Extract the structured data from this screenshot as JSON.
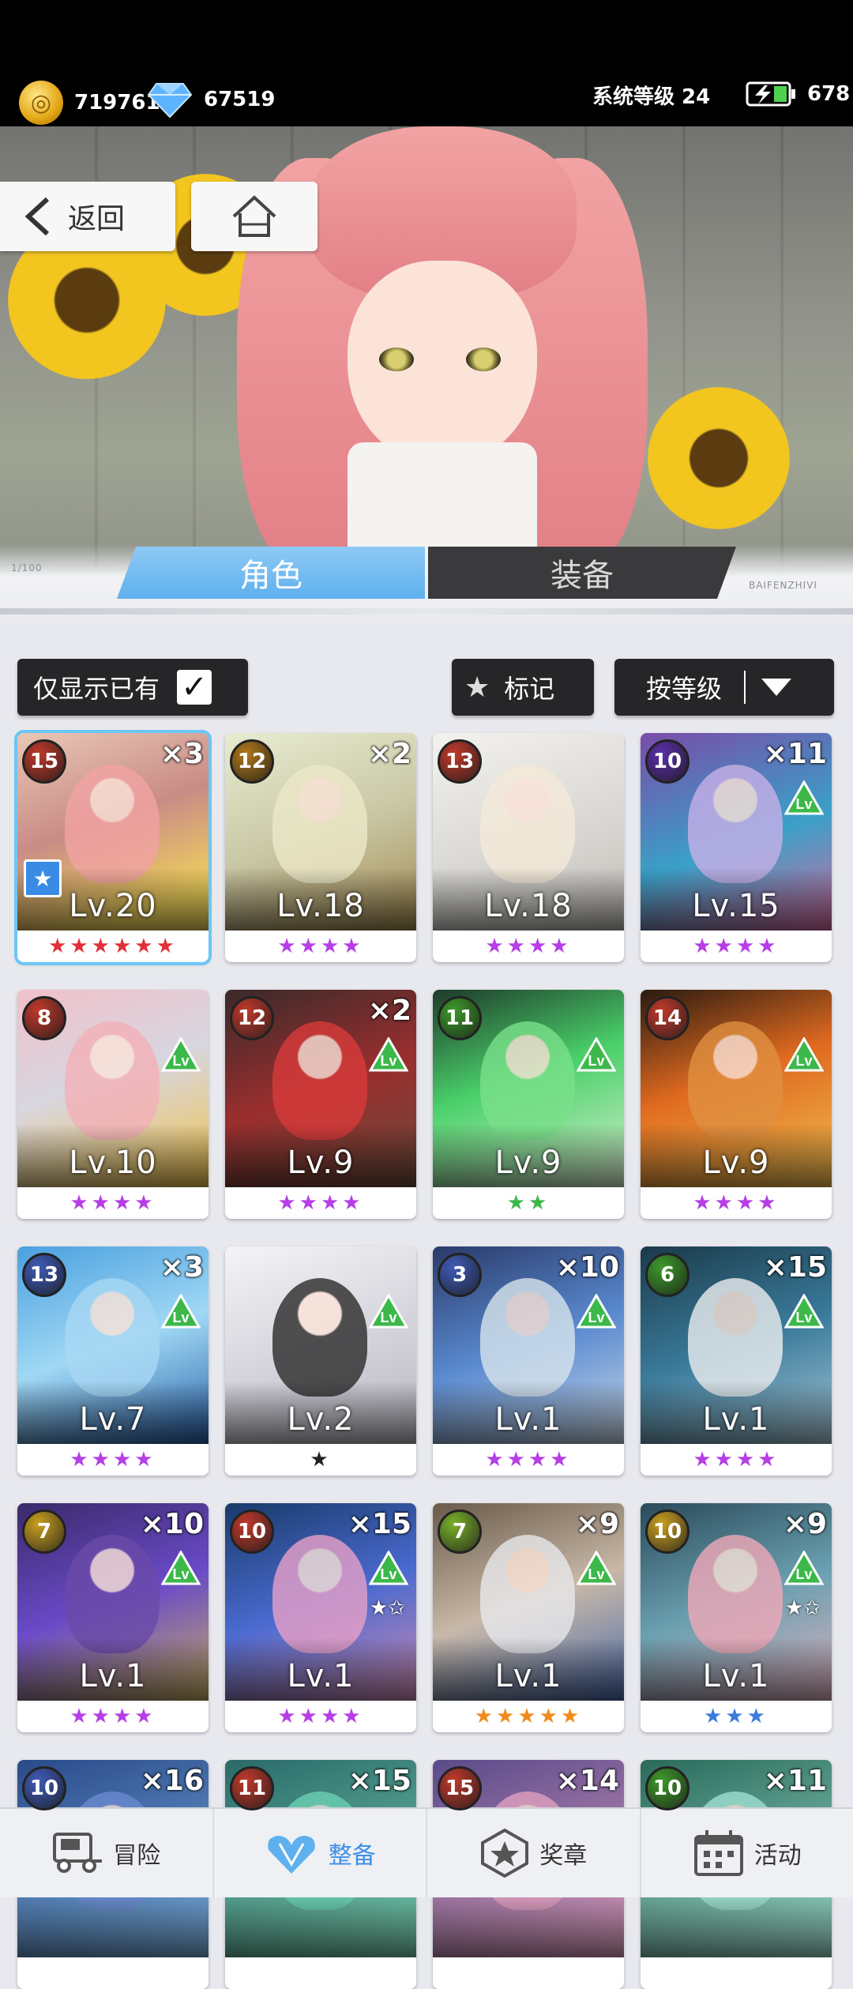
{
  "status": {
    "gold": "719761",
    "diamonds": "67519",
    "system_level": "系统等级 24",
    "energy": "678"
  },
  "nav": {
    "back_label": "返回"
  },
  "tabs": [
    {
      "label": "角色",
      "active": true
    },
    {
      "label": "装备",
      "active": false
    }
  ],
  "decor": {
    "counter": "1/100",
    "right_caption": "BAIFENZHIVI"
  },
  "filters": {
    "owned_only_label": "仅显示已有",
    "owned_only_checked": true,
    "mark_label": "标记",
    "sort_label": "按等级"
  },
  "cards": [
    {
      "rank": "15",
      "mult": "×3",
      "level": "Lv.20",
      "stars": "★★★★★★",
      "star_color": "#e0303a",
      "selected": true,
      "marked": true
    },
    {
      "rank": "12",
      "mult": "×2",
      "level": "Lv.18",
      "stars": "★★★★",
      "star_color": "#b63ee6"
    },
    {
      "rank": "13",
      "mult": "",
      "level": "Lv.18",
      "stars": "★★★★",
      "star_color": "#b63ee6"
    },
    {
      "rank": "10",
      "mult": "×11",
      "level": "Lv.15",
      "stars": "★★★★",
      "star_color": "#b63ee6",
      "lv_up": true
    },
    {
      "rank": "8",
      "mult": "",
      "level": "Lv.10",
      "stars": "★★★★",
      "star_color": "#b63ee6",
      "lv_up": true
    },
    {
      "rank": "12",
      "mult": "×2",
      "level": "Lv.9",
      "stars": "★★★★",
      "star_color": "#b63ee6",
      "lv_up": true
    },
    {
      "rank": "11",
      "mult": "",
      "level": "Lv.9",
      "stars": "★★",
      "star_color": "#3cb84a",
      "lv_up": true
    },
    {
      "rank": "14",
      "mult": "",
      "level": "Lv.9",
      "stars": "★★★★",
      "star_color": "#b63ee6",
      "lv_up": true
    },
    {
      "rank": "13",
      "mult": "×3",
      "level": "Lv.7",
      "stars": "★★★★",
      "star_color": "#b63ee6",
      "lv_up": true
    },
    {
      "rank": "",
      "mult": "",
      "level": "Lv.2",
      "stars": "★",
      "star_color": "#222222",
      "lv_up": true
    },
    {
      "rank": "3",
      "mult": "×10",
      "level": "Lv.1",
      "stars": "★★★★",
      "star_color": "#b63ee6",
      "lv_up": true
    },
    {
      "rank": "6",
      "mult": "×15",
      "level": "Lv.1",
      "stars": "★★★★",
      "star_color": "#b63ee6",
      "lv_up": true
    },
    {
      "rank": "7",
      "mult": "×10",
      "level": "Lv.1",
      "stars": "★★★★",
      "star_color": "#b63ee6",
      "lv_up": true
    },
    {
      "rank": "10",
      "mult": "×15",
      "level": "Lv.1",
      "stars": "★★★★",
      "star_color": "#b63ee6",
      "lv_up": true,
      "star_up": true
    },
    {
      "rank": "7",
      "mult": "×9",
      "level": "Lv.1",
      "stars": "★★★★★",
      "star_color": "#f08a1c",
      "lv_up": true
    },
    {
      "rank": "10",
      "mult": "×9",
      "level": "Lv.1",
      "stars": "★★★",
      "star_color": "#3b7be0",
      "lv_up": true,
      "star_up": true
    },
    {
      "rank": "10",
      "mult": "×16",
      "level": "",
      "stars": "",
      "star_color": "#b63ee6"
    },
    {
      "rank": "11",
      "mult": "×15",
      "level": "",
      "stars": "",
      "star_color": "#b63ee6"
    },
    {
      "rank": "15",
      "mult": "×14",
      "level": "",
      "stars": "",
      "star_color": "#b63ee6"
    },
    {
      "rank": "10",
      "mult": "×11",
      "level": "",
      "stars": "",
      "star_color": "#b63ee6"
    }
  ],
  "bottom_nav": [
    {
      "label": "冒险",
      "icon": "truck-icon",
      "active": false
    },
    {
      "label": "整备",
      "icon": "heart-wing-icon",
      "active": true
    },
    {
      "label": "奖章",
      "icon": "medal-icon",
      "active": false
    },
    {
      "label": "活动",
      "icon": "calendar-icon",
      "active": false
    }
  ],
  "colors": {
    "accent_blue": "#5fb0ee",
    "selected_outline": "#6cc6f6"
  }
}
